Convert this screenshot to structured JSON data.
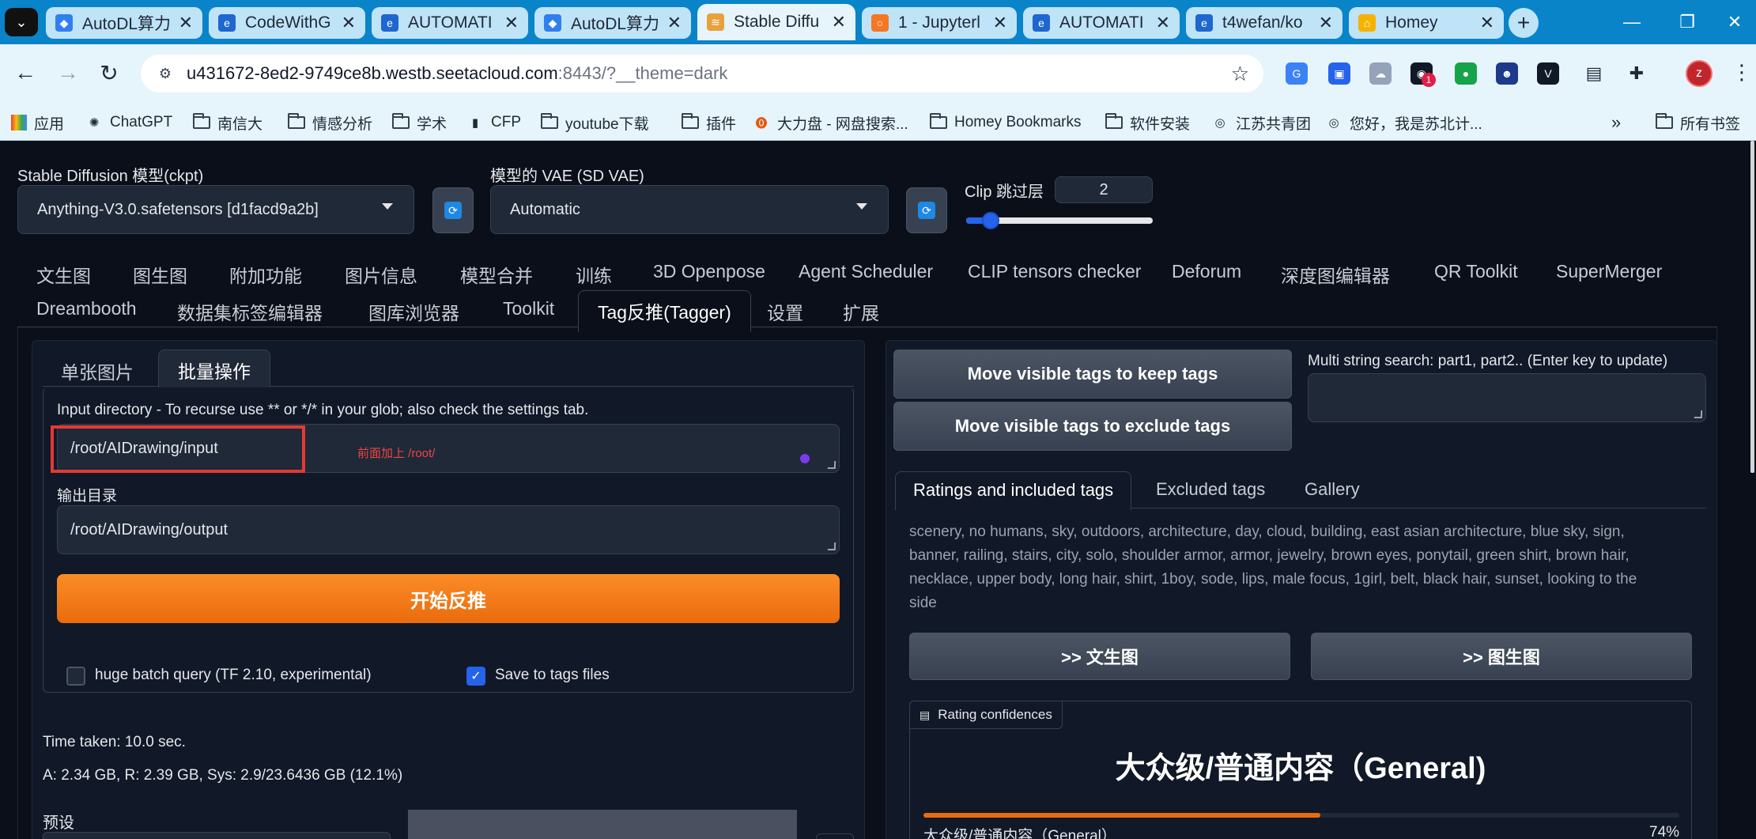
{
  "browser": {
    "tabs": [
      {
        "title": "AutoDL算力",
        "color": "#2f80ed"
      },
      {
        "title": "CodeWithG",
        "color": "#1e66d0"
      },
      {
        "title": "AUTOMATI",
        "color": "#1e66d0"
      },
      {
        "title": "AutoDL算力",
        "color": "#2f80ed"
      },
      {
        "title": "Stable Diffu",
        "color": "#e8a13a"
      },
      {
        "title": "1 - Jupyterl",
        "color": "#f37726"
      },
      {
        "title": "AUTOMATI",
        "color": "#1e66d0"
      },
      {
        "title": "t4wefan/ko",
        "color": "#1e66d0"
      },
      {
        "title": "Homey",
        "color": "#f5b301"
      }
    ],
    "url_host": "u431672-8ed2-9749ce8b.westb.seetacloud.com",
    "url_rest": ":8443/?__theme=dark",
    "profile_letter": "z",
    "ext_badge": "1",
    "bookmarks": [
      "应用",
      "ChatGPT",
      "南信大",
      "情感分析",
      "学术",
      "CFP",
      "youtube下载",
      "插件",
      "大力盘 - 网盘搜索...",
      "Homey Bookmarks",
      "软件安装",
      "江苏共青团",
      "您好，我是苏北计...",
      "所有书签"
    ]
  },
  "top": {
    "model_label": "Stable Diffusion 模型(ckpt)",
    "model_value": "Anything-V3.0.safetensors [d1facd9a2b]",
    "vae_label": "模型的 VAE (SD VAE)",
    "vae_value": "Automatic",
    "clip_label": "Clip 跳过层",
    "clip_value": "2",
    "clip_level": 0.1
  },
  "main_tabs_row1": [
    "文生图",
    "图生图",
    "附加功能",
    "图片信息",
    "模型合并",
    "训练",
    "3D Openpose",
    "Agent Scheduler",
    "CLIP tensors checker",
    "Deforum",
    "深度图编辑器",
    "QR Toolkit",
    "SuperMerger"
  ],
  "main_tabs_row2": [
    "Dreambooth",
    "数据集标签编辑器",
    "图库浏览器",
    "Toolkit",
    "Tag反推(Tagger)",
    "设置",
    "扩展"
  ],
  "left": {
    "subtabs": [
      "单张图片",
      "批量操作"
    ],
    "input_label": "Input directory - To recurse use ** or */* in your glob; also check the settings tab.",
    "input_value": "/root/AIDrawing/input",
    "annotation": "前面加上  /root/",
    "output_label": "输出目录",
    "output_value": "/root/AIDrawing/output",
    "start_button": "开始反推",
    "check1": "huge batch query (TF 2.10, experimental)",
    "check2": "Save to tags files",
    "time_taken": "Time taken: 10.0 sec.",
    "mem": "A: 2.34 GB, R: 2.39 GB, Sys: 2.9/23.6436 GB (12.1%)",
    "preset_label": "预设"
  },
  "right": {
    "btn_keep": "Move visible tags to keep tags",
    "btn_exclude": "Move visible tags to exclude tags",
    "search_label": "Multi string search: part1, part2.. (Enter key to update)",
    "tabs": [
      "Ratings and included tags",
      "Excluded tags",
      "Gallery"
    ],
    "tags": "scenery, no humans, sky, outdoors, architecture, day, cloud, building, east asian architecture, blue sky, sign, banner, railing, stairs, city, solo, shoulder armor, armor, jewelry, brown eyes, ponytail, green shirt, brown hair, necklace, upper body, long hair, shirt, 1boy, sode, lips, male focus, 1girl, belt, black hair, sunset, looking to the side",
    "btn_txt2img": ">> 文生图",
    "btn_img2img": ">> 图生图",
    "rating_header": "Rating confidences",
    "rating_title": "大众级/普通内容（General)",
    "rating_row_label": "大众级/普通内容（General）",
    "rating_row_value": "74%",
    "rating_fraction": 0.74
  }
}
